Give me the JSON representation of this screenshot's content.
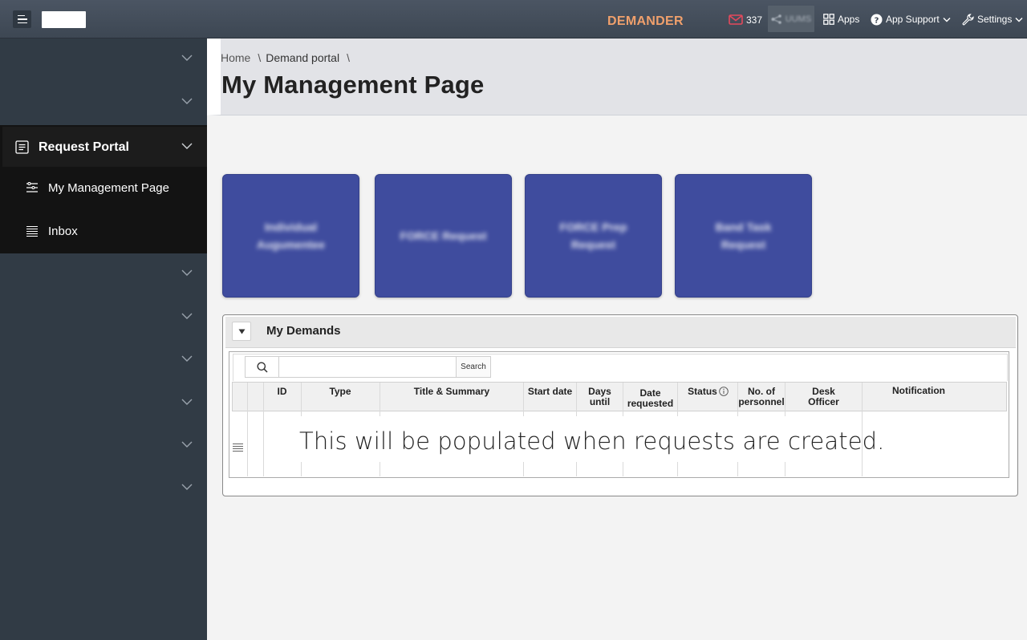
{
  "topbar": {
    "app_title": "DEMANDER",
    "mail_count": "337",
    "share_label": "UUMS",
    "apps_label": "Apps",
    "support_label": "App Support",
    "settings_label": "Settings"
  },
  "sidebar": {
    "active_section": {
      "label": "Request Portal",
      "items": [
        {
          "label": "My Management Page"
        },
        {
          "label": "Inbox"
        }
      ]
    }
  },
  "breadcrumb": {
    "items": [
      "Home",
      "Demand portal"
    ]
  },
  "page": {
    "title": "My Management Page"
  },
  "tiles": [
    {
      "label": "Individual Augumentee"
    },
    {
      "label": "FORCE Request"
    },
    {
      "label": "FORCE Prep Request"
    },
    {
      "label": "Band Task Request"
    }
  ],
  "demands": {
    "title": "My Demands",
    "search_button": "Search",
    "search_value": "",
    "columns": {
      "id": "ID",
      "type": "Type",
      "title_summary": "Title & Summary",
      "start_date": "Start date",
      "days_until_1": "Days",
      "days_until_2": "until",
      "date_requested_1": "Date",
      "date_requested_2": "requested",
      "status": "Status",
      "personnel_1": "No. of",
      "personnel_2": "personnel",
      "desk_officer_1": "Desk",
      "desk_officer_2": "Officer",
      "notification": "Notification"
    },
    "empty_message": "This will be populated when requests are created."
  },
  "colors": {
    "topbar": "#434d59",
    "sidebar": "#313b45",
    "accent_title": "#f0a06c",
    "tile": "#3f4c9e"
  }
}
